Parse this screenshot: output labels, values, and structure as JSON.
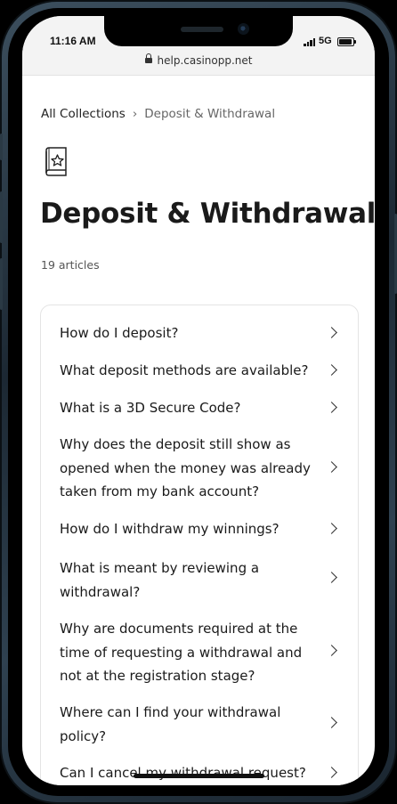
{
  "status_bar": {
    "time": "11:16 AM",
    "network": "5G"
  },
  "browser": {
    "url": "help.casinopp.net"
  },
  "breadcrumb": {
    "root": "All Collections",
    "separator": "›",
    "current": "Deposit & Withdrawal"
  },
  "collection": {
    "icon": "star-book-icon",
    "title": "Deposit & Withdrawal",
    "article_count": "19 articles"
  },
  "articles": [
    "How do I deposit?",
    "What deposit methods are available?",
    "What is a 3D Secure Code?",
    "Why does the deposit still show as opened when the money was already taken from my bank account?",
    "How do I withdraw my winnings?",
    "What is meant by reviewing a withdrawal?",
    "Why are documents required at the time of requesting a withdrawal and not at the registration stage?",
    "Where can I find your withdrawal policy?",
    "Can I cancel my withdrawal request?"
  ]
}
